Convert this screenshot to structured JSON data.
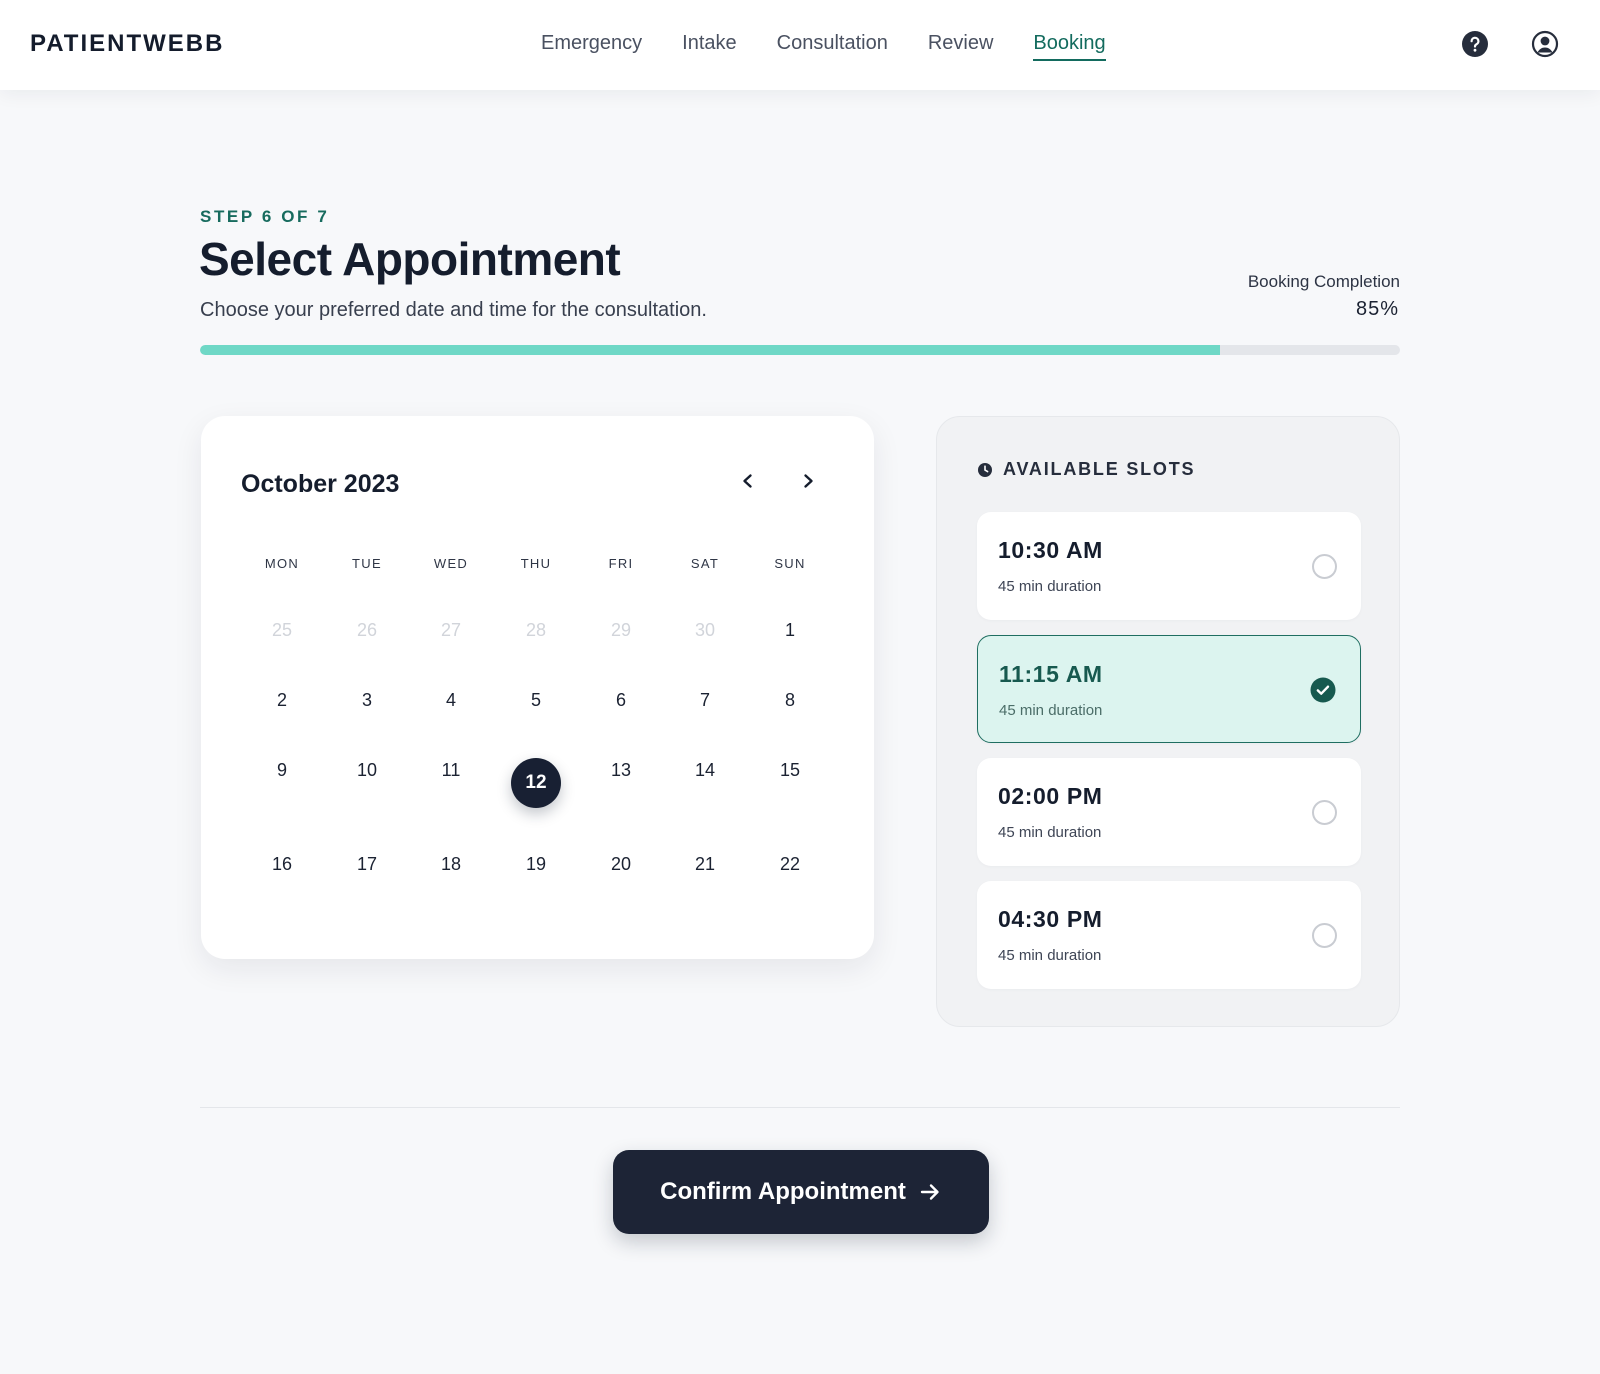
{
  "app": {
    "brand": "PATIENTWEBB"
  },
  "nav": {
    "items": [
      {
        "label": "Emergency"
      },
      {
        "label": "Intake"
      },
      {
        "label": "Consultation"
      },
      {
        "label": "Review"
      },
      {
        "label": "Booking",
        "active": true
      }
    ]
  },
  "header_icons": [
    "help-icon",
    "user-icon"
  ],
  "page": {
    "step": "STEP 6 OF 7",
    "title": "Select Appointment",
    "subtitle": "Choose your preferred date and time for the consultation.",
    "completion_label": "Booking Completion",
    "completion_value": "85%",
    "completion_fraction": 0.85
  },
  "calendar": {
    "month": "October 2023",
    "weekdays": [
      "MON",
      "TUE",
      "WED",
      "THU",
      "FRI",
      "SAT",
      "SUN"
    ],
    "weeks": [
      [
        "25",
        "26",
        "27",
        "28",
        "29",
        "30",
        "1"
      ],
      [
        "2",
        "3",
        "4",
        "5",
        "6",
        "7",
        "8"
      ],
      [
        "9",
        "10",
        "11",
        "12",
        "13",
        "14",
        "15"
      ],
      [
        "16",
        "17",
        "18",
        "19",
        "20",
        "21",
        "22"
      ]
    ],
    "previous_month_days": [
      "25",
      "26",
      "27",
      "28",
      "29",
      "30"
    ],
    "selected_day": "12"
  },
  "slots": {
    "heading": "AVAILABLE SLOTS",
    "items": [
      {
        "time": "10:30 AM",
        "duration": "45 min duration",
        "selected": false
      },
      {
        "time": "11:15 AM",
        "duration": "45 min duration",
        "selected": true
      },
      {
        "time": "02:00 PM",
        "duration": "45 min duration",
        "selected": false
      },
      {
        "time": "04:30 PM",
        "duration": "45 min duration",
        "selected": false
      }
    ]
  },
  "confirm": {
    "label": "Confirm Appointment"
  },
  "colors": {
    "accent": "#136b5e",
    "progress": "#6fd8c6",
    "dark": "#1d2436",
    "selected_slot_bg": "#dcf4ef"
  }
}
